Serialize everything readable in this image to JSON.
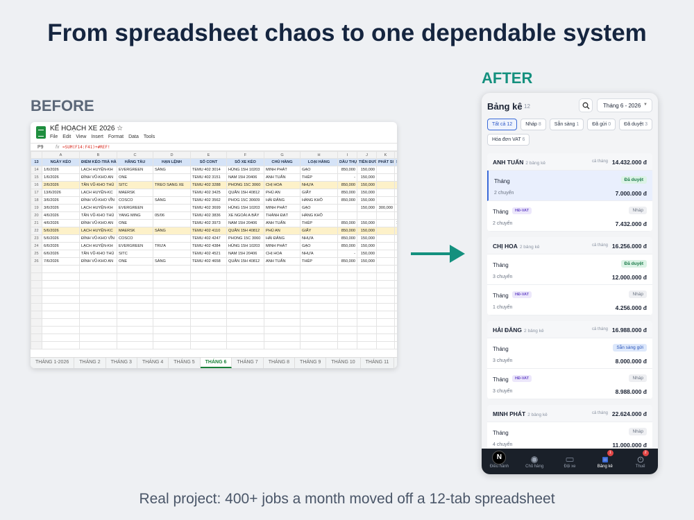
{
  "headline": "From spreadsheet chaos to one dependable system",
  "before_label": "BEFORE",
  "after_label": "AFTER",
  "footer": "Real project: 400+ jobs a month moved off a 12-tab spreadsheet",
  "sheet": {
    "title": "KẾ HOẠCH XE 2026 ☆",
    "menu": [
      "File",
      "Edit",
      "View",
      "Insert",
      "Format",
      "Data",
      "Tools"
    ],
    "cell_ref": "P9",
    "fx": "fx",
    "formula": "=SUM(F14:F41)+#REF!",
    "col_letters": [
      "",
      "A",
      "B",
      "C",
      "D",
      "E",
      "F",
      "G",
      "H",
      "I",
      "J",
      "K",
      ""
    ],
    "header_row": [
      "13",
      "NGÀY KÉO",
      "ĐIỂM KÉO-TRẢ HÀ",
      "HÃNG TÀU",
      "HẠN LỆNH",
      "SỐ CONT",
      "SỐ XE KÉO",
      "CHỦ HÀNG",
      "LOẠI HÀNG",
      "DẦU THỰ",
      "TIỀN ĐƯỜ",
      "PHÁT SI",
      "S"
    ],
    "rows": [
      [
        "14",
        "1/6/2026",
        "LẠCH HUYỆN-KH",
        "EVERGREEN",
        "SÁNG",
        "TEMU 402 3014",
        "HÙNG 15H 10203",
        "MINH PHÁT",
        "GẠO",
        "850,000",
        "150,000",
        "",
        ""
      ],
      [
        "15",
        "1/6/2026",
        "ĐÌNH VŨ-KHO AN",
        "ONE",
        "",
        "TEMU 402 3151",
        "NAM 15H 20406",
        "ANH TUẤN",
        "THÉP",
        "-",
        "150,000",
        "",
        ""
      ],
      [
        "16",
        "2/6/2026",
        "TÂN VŨ-KHO THỦ",
        "SITC",
        "TREO SANG XE",
        "TEMU 402 3288",
        "PHONG 15C 3060",
        "CHỊ HOA",
        "NHỰA",
        "850,000",
        "150,000",
        "",
        ""
      ],
      [
        "17",
        "13/6/2026",
        "LẠCH HUYỆN-KC",
        "MAERSK",
        "",
        "TEMU 402 3425",
        "QUÂN 15H 40812",
        "PHÚ AN",
        "GIẤY",
        "850,000",
        "150,000",
        "",
        ""
      ],
      [
        "18",
        "3/6/2026",
        "ĐÌNH VŨ-KHO VĨN",
        "COSCO",
        "SÁNG",
        "TEMU 402 3562",
        "PHOG 15C 30609",
        "HẢI ĐĂNG",
        "HÀNG KHÔ",
        "850,000",
        "150,000",
        "",
        ""
      ],
      [
        "19",
        "3/6/2026",
        "LẠCH HUYỆN-KH",
        "EVERGREEN",
        "",
        "TEMU 402 3699",
        "HÙNG 15H 10203",
        "MINH PHÁT",
        "GẠO",
        "",
        "150,000",
        "300,000",
        ""
      ],
      [
        "20",
        "4/6/2026",
        "TÂN VŨ-KHO THỦ",
        "YANG MING",
        "05/06",
        "TEMU 402 3836",
        "XE NGOÀI A BẢY",
        "THÀNH ĐẠT",
        "HÀNG KHÔ",
        "",
        "",
        "",
        ""
      ],
      [
        "21",
        "4/6/2026",
        "ĐÌNH VŨ-KHO AN",
        "ONE",
        "",
        "TEMU 402 3973",
        "NAM 15H 20406",
        "ANH TUẤN",
        "THÉP",
        "850,000",
        "150,000",
        "",
        "1"
      ],
      [
        "22",
        "5/6/2026",
        "LẠCH HUYỆN-KC",
        "MAERSK",
        "SÁNG",
        "TEMU 402 4110",
        "QUÂN 15H 40812",
        "PHÚ AN",
        "GIẤY",
        "850,000",
        "150,000",
        "",
        ""
      ],
      [
        "23",
        "5/6/2026",
        "ĐÌNH VŨ-KHO VĨN",
        "COSCO",
        "",
        "TEMU 402 4247",
        "PHONG 15C 3060",
        "HẢI ĐĂNG",
        "NHỰA",
        "850,000",
        "150,000",
        "",
        ""
      ],
      [
        "24",
        "6/6/2026",
        "LẠCH HUYỆN-KH",
        "EVERGREEN",
        "TRƯA",
        "TEMU 402 4384",
        "HÙNG 15H 10203",
        "MINH PHÁT",
        "GẠO",
        "850,000",
        "150,000",
        "",
        ""
      ],
      [
        "25",
        "6/6/2026",
        "TÂN VŨ-KHO THỦ",
        "SITC",
        "",
        "TEMU 402 4521",
        "NAM 15H 20406",
        "CHỊ HOA",
        "NHỰA",
        "-",
        "150,000",
        "",
        ""
      ],
      [
        "26",
        "7/6/2026",
        "ĐÌNH VŨ-KHO AN",
        "ONE",
        "SÁNG",
        "TEMU 402 4658",
        "QUÂN 15H 40812",
        "ANH TUẤN",
        "THÉP",
        "850,000",
        "150,000",
        "",
        ""
      ]
    ],
    "tabs": [
      "THÁNG 1-2026",
      "THÁNG 2",
      "THÁNG 3",
      "THÁNG 4",
      "THÁNG 5",
      "THÁNG 6",
      "THÁNG 7",
      "THÁNG 8",
      "THÁNG 9",
      "THÁNG 10",
      "THÁNG 11",
      "T"
    ],
    "active_tab": "THÁNG 6"
  },
  "app": {
    "title": "Bảng kê",
    "count": "12",
    "month": "Tháng 6 - 2026",
    "chips": [
      {
        "label": "Tất cả",
        "count": "12",
        "active": true
      },
      {
        "label": "Nháp",
        "count": "8"
      },
      {
        "label": "Sẵn sàng",
        "count": "1"
      },
      {
        "label": "Đã gửi",
        "count": "0"
      },
      {
        "label": "Đã duyệt",
        "count": "3"
      },
      {
        "label": "Hóa đơn VAT",
        "count": "6"
      }
    ],
    "groups": [
      {
        "name": "ANH TUẤN",
        "sub": "2 bảng kê",
        "total_label": "cả tháng",
        "total": "14.432.000 đ",
        "items": [
          {
            "label": "Tháng",
            "tag": "",
            "badge": "Đã duyệt",
            "badge_type": "ok",
            "trips": "2 chuyến",
            "amount": "7.000.000 đ",
            "selected": true
          },
          {
            "label": "Tháng",
            "tag": "HĐ-VAT",
            "badge": "Nháp",
            "badge_type": "draft",
            "trips": "2 chuyến",
            "amount": "7.432.000 đ"
          }
        ]
      },
      {
        "name": "CHỊ HOA",
        "sub": "2 bảng kê",
        "total_label": "cả tháng",
        "total": "16.256.000 đ",
        "items": [
          {
            "label": "Tháng",
            "tag": "",
            "badge": "Đã duyệt",
            "badge_type": "ok",
            "trips": "3 chuyến",
            "amount": "12.000.000 đ"
          },
          {
            "label": "Tháng",
            "tag": "HĐ-VAT",
            "badge": "Nháp",
            "badge_type": "draft",
            "trips": "1 chuyến",
            "amount": "4.256.000 đ"
          }
        ]
      },
      {
        "name": "HẢI ĐĂNG",
        "sub": "2 bảng kê",
        "total_label": "cả tháng",
        "total": "16.988.000 đ",
        "items": [
          {
            "label": "Tháng",
            "tag": "",
            "badge": "Sẵn sàng gửi",
            "badge_type": "ready",
            "trips": "3 chuyến",
            "amount": "8.000.000 đ"
          },
          {
            "label": "Tháng",
            "tag": "HĐ-VAT",
            "badge": "Nháp",
            "badge_type": "draft",
            "trips": "3 chuyến",
            "amount": "8.988.000 đ"
          }
        ]
      },
      {
        "name": "MINH PHÁT",
        "sub": "2 bảng kê",
        "total_label": "cả tháng",
        "total": "22.624.000 đ",
        "items": [
          {
            "label": "Tháng",
            "tag": "",
            "badge": "Nháp",
            "badge_type": "draft",
            "trips": "4 chuyến",
            "amount": "11.000.000 đ"
          }
        ]
      }
    ],
    "nav": [
      {
        "label": "Điều hành",
        "icon": "logo",
        "badge": ""
      },
      {
        "label": "Chủ hàng",
        "icon": "circle",
        "badge": ""
      },
      {
        "label": "Đội xe",
        "icon": "truck",
        "badge": ""
      },
      {
        "label": "Bảng kê",
        "icon": "list",
        "badge": "1",
        "active": true
      },
      {
        "label": "Thuế",
        "icon": "clock",
        "badge": "2"
      }
    ],
    "nav_logo_letter": "N"
  }
}
